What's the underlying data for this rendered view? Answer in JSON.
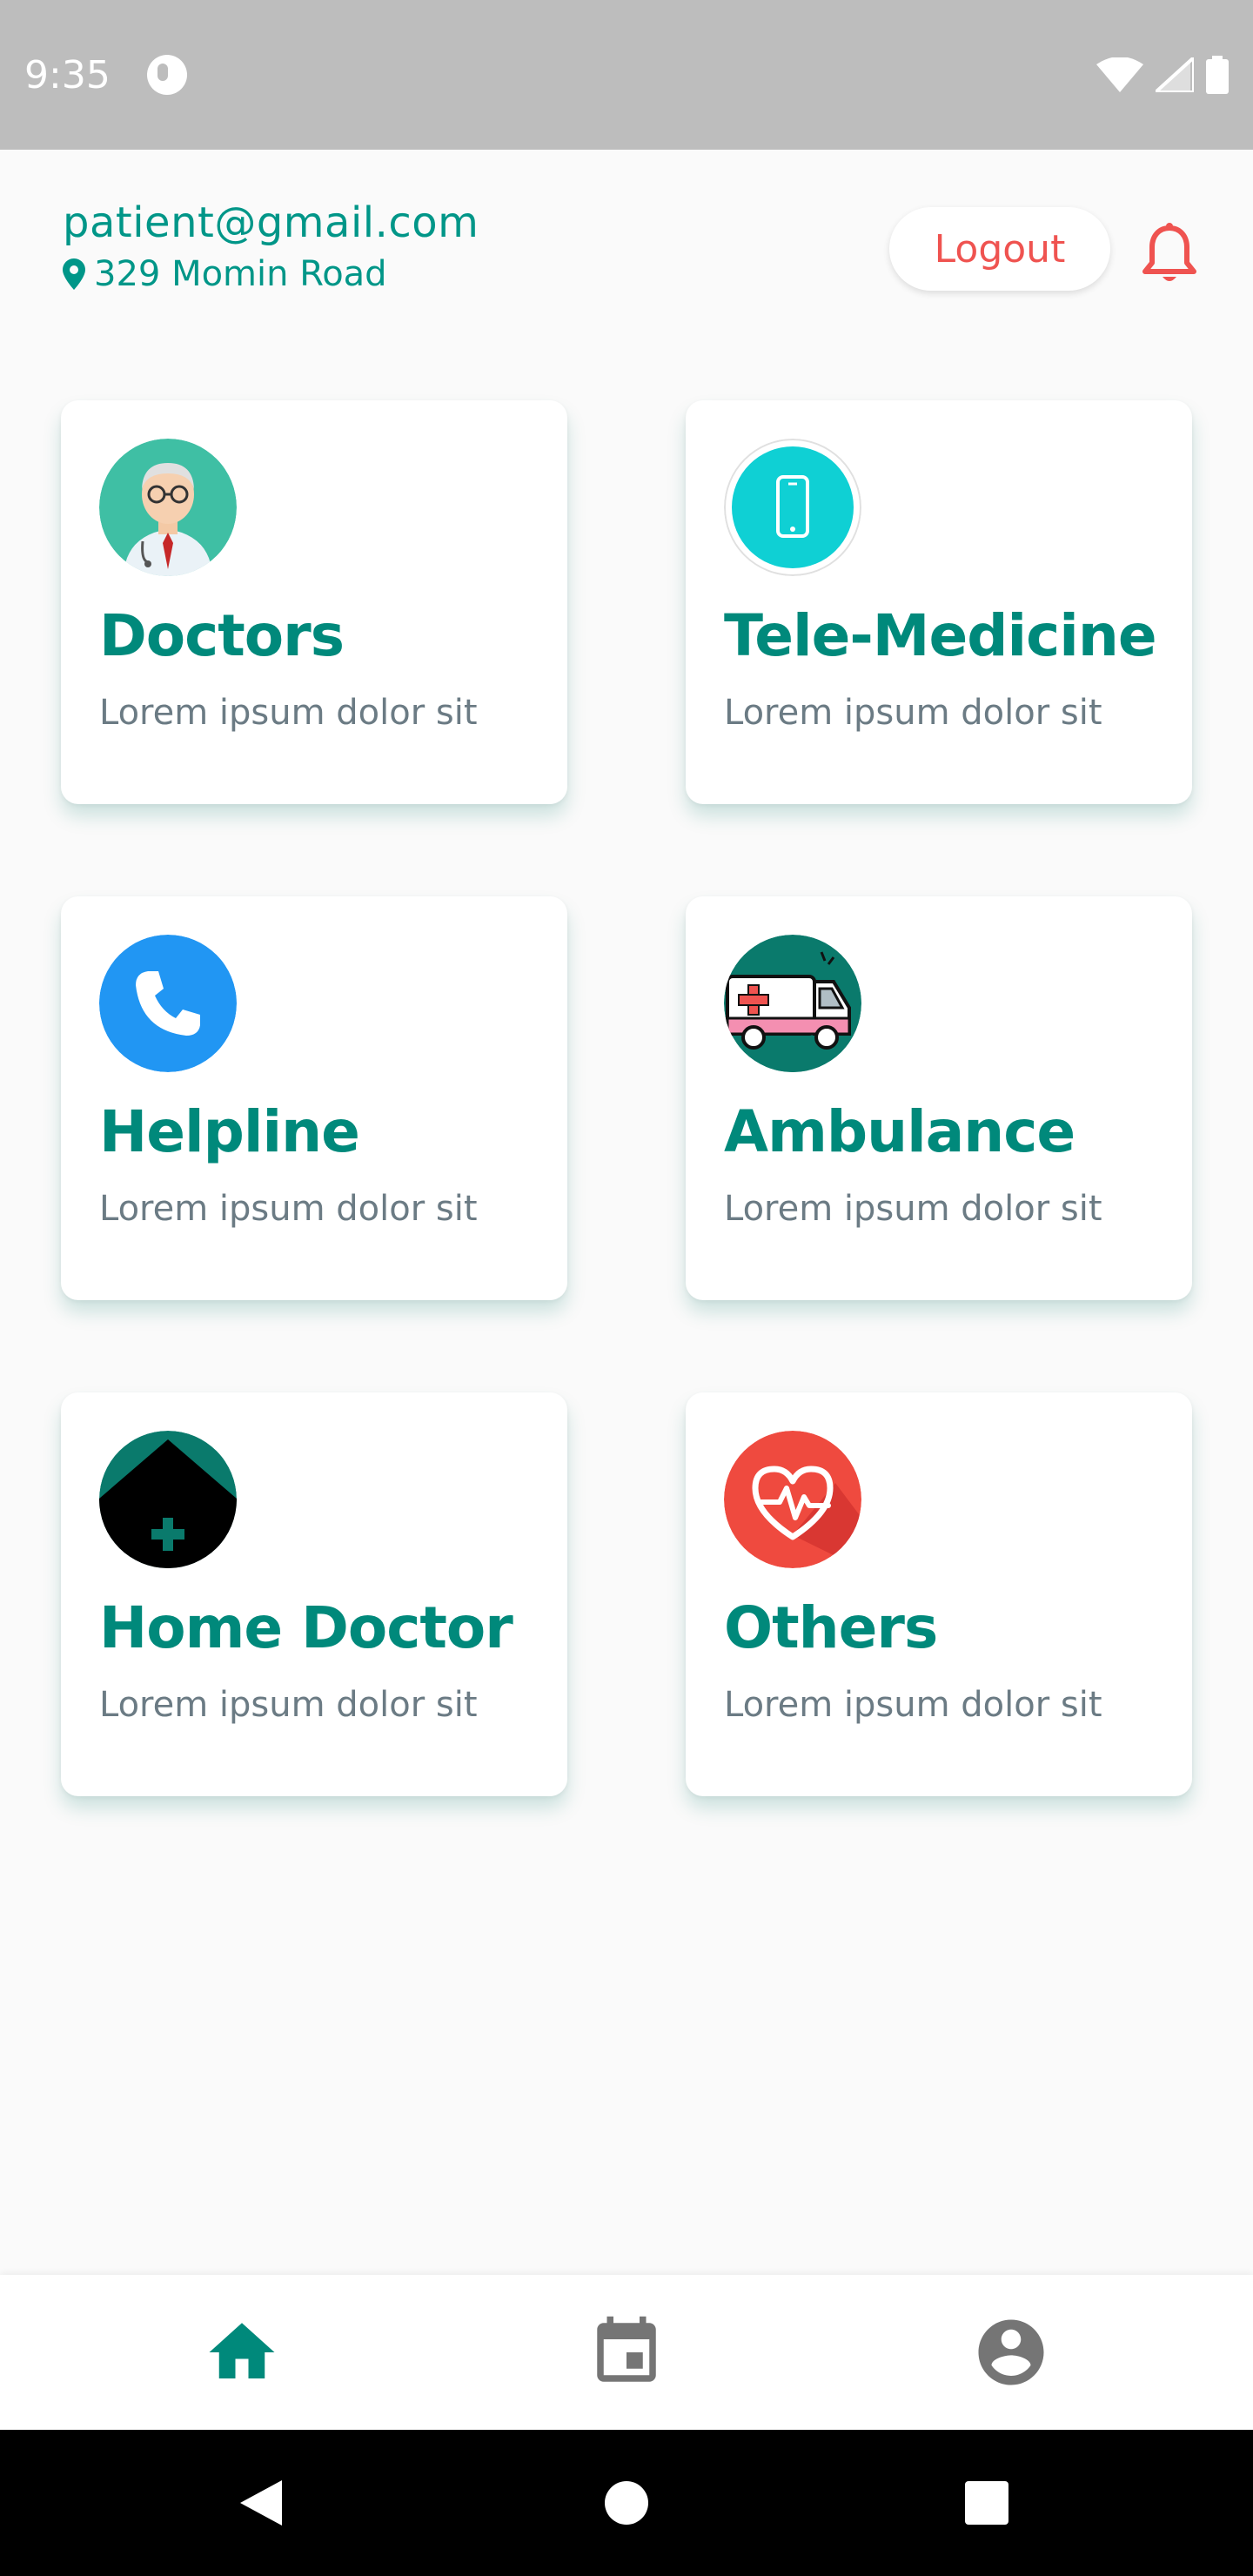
{
  "status_bar": {
    "time": "9:35"
  },
  "header": {
    "email": "patient@gmail.com",
    "address": "329 Momin Road",
    "logout_label": "Logout"
  },
  "cards": [
    {
      "title": "Doctors",
      "description": "Lorem ipsum dolor sit",
      "icon": "doctor-icon"
    },
    {
      "title": "Tele-Medicine",
      "description": "Lorem ipsum dolor sit",
      "icon": "smartphone-icon"
    },
    {
      "title": "Helpline",
      "description": "Lorem ipsum dolor sit",
      "icon": "phone-icon"
    },
    {
      "title": "Ambulance",
      "description": "Lorem ipsum dolor sit",
      "icon": "ambulance-icon"
    },
    {
      "title": "Home Doctor",
      "description": "Lorem ipsum dolor sit",
      "icon": "home-medical-icon"
    },
    {
      "title": "Others",
      "description": "Lorem ipsum dolor sit",
      "icon": "heartbeat-icon"
    }
  ],
  "bottom_nav": {
    "items": [
      {
        "icon": "home-icon",
        "active": true
      },
      {
        "icon": "calendar-icon",
        "active": false
      },
      {
        "icon": "account-icon",
        "active": false
      }
    ]
  },
  "colors": {
    "primary": "#00897b",
    "accent_red": "#ef5350",
    "background": "#fafafa",
    "status_bar": "#bdbdbd",
    "nav_inactive": "#757575"
  }
}
